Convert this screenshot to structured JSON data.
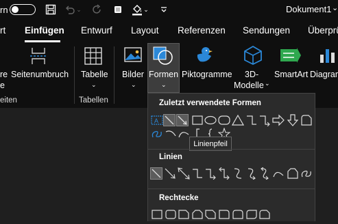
{
  "titlebar": {
    "autosave_fragment": "rn",
    "document_title": "Dokument1",
    "title_chevron": "⌄"
  },
  "tabs": [
    {
      "label": "rt"
    },
    {
      "label": "Einfügen"
    },
    {
      "label": "Entwurf"
    },
    {
      "label": "Layout"
    },
    {
      "label": "Referenzen"
    },
    {
      "label": "Sendungen"
    },
    {
      "label": "Überprü"
    }
  ],
  "ribbon": {
    "cut_item_line1": "re",
    "cut_item_line2": "e",
    "seitenumbruch": "Seitenumbruch",
    "tabelle": "Tabelle",
    "bilder": "Bilder",
    "formen": "Formen",
    "piktogramme": "Piktogramme",
    "modelle_line1": "3D-",
    "modelle_line2": "Modelle",
    "smartart": "SmartArt",
    "diagramm": "Diagram",
    "groups": {
      "seiten": "eiten",
      "tabellen": "Tabellen"
    },
    "caret": "⌄"
  },
  "shapes_panel": {
    "recent_title": "Zuletzt verwendete Formen",
    "lines_title": "Linien",
    "rect_title": "Rechtecke",
    "tooltip": "Linienpfeil",
    "recent_text_box_glyph": "A"
  },
  "colors": {
    "background": "#1f1f1f",
    "ribbon": "#0f0f0f",
    "panel": "#2b2b2b",
    "selected": "#5c5c5c",
    "smartart_green": "#2fa84f",
    "model_blue": "#2b88d8"
  }
}
